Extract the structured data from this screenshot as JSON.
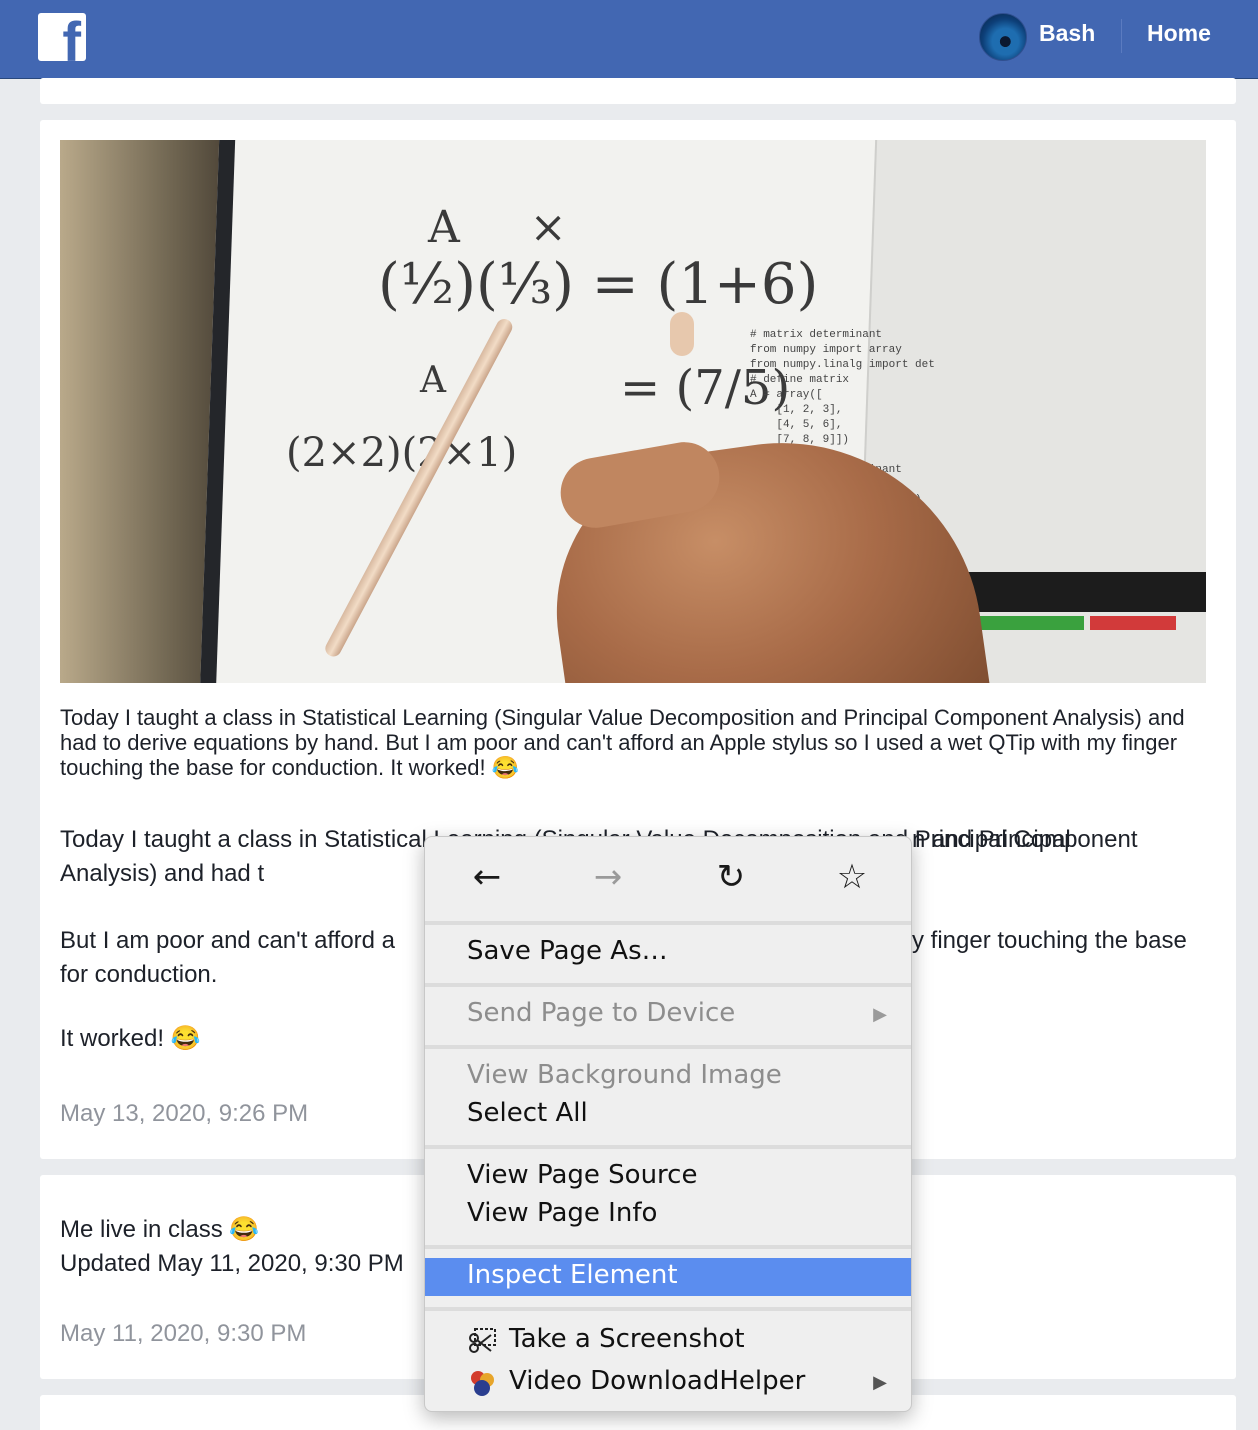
{
  "header": {
    "logo_letter": "f",
    "user_name": "Bash",
    "home_label": "Home",
    "brand_color": "#4267b2"
  },
  "post": {
    "photo_alt": "Hand holding QTip stylus over tablet with handwritten matrix equations",
    "caption": "Today I taught a class in Statistical Learning (Singular Value Decomposition and Principal Component Analysis) and had to derive equations by hand. But I am poor and can't afford an Apple stylus so I used a wet QTip with my finger touching the base for conduction. It worked! 😂",
    "para1": "Today I taught a class in Statistical Learning (Singular Value Decomposition and Principal Component Analysis) and had t",
    "para1_tail": "n and Principal",
    "para2": "But I am poor and can't afford a",
    "para2_tail": "y finger touching the base",
    "para2_end": "for conduction.",
    "para3": "It worked! 😂",
    "timestamp": "May 13, 2020, 9:26 PM"
  },
  "post2": {
    "text": "Me live in class 😂",
    "updated": "Updated May 11, 2020, 9:30 PM",
    "timestamp": "May 11, 2020, 9:30 PM"
  },
  "context_menu": {
    "back_icon": "arrow-left-icon",
    "forward_icon": "arrow-right-icon",
    "reload_icon": "reload-icon",
    "bookmark_icon": "star-icon",
    "items": {
      "save_page_as": "Save Page As…",
      "send_page_to_device": "Send Page to Device",
      "view_background_image": "View Background Image",
      "select_all": "Select All",
      "view_page_source": "View Page Source",
      "view_page_info": "View Page Info",
      "inspect_element": "Inspect Element",
      "take_screenshot": "Take a Screenshot",
      "video_downloadhelper": "Video DownloadHelper"
    },
    "highlight_color": "#5b8def"
  }
}
